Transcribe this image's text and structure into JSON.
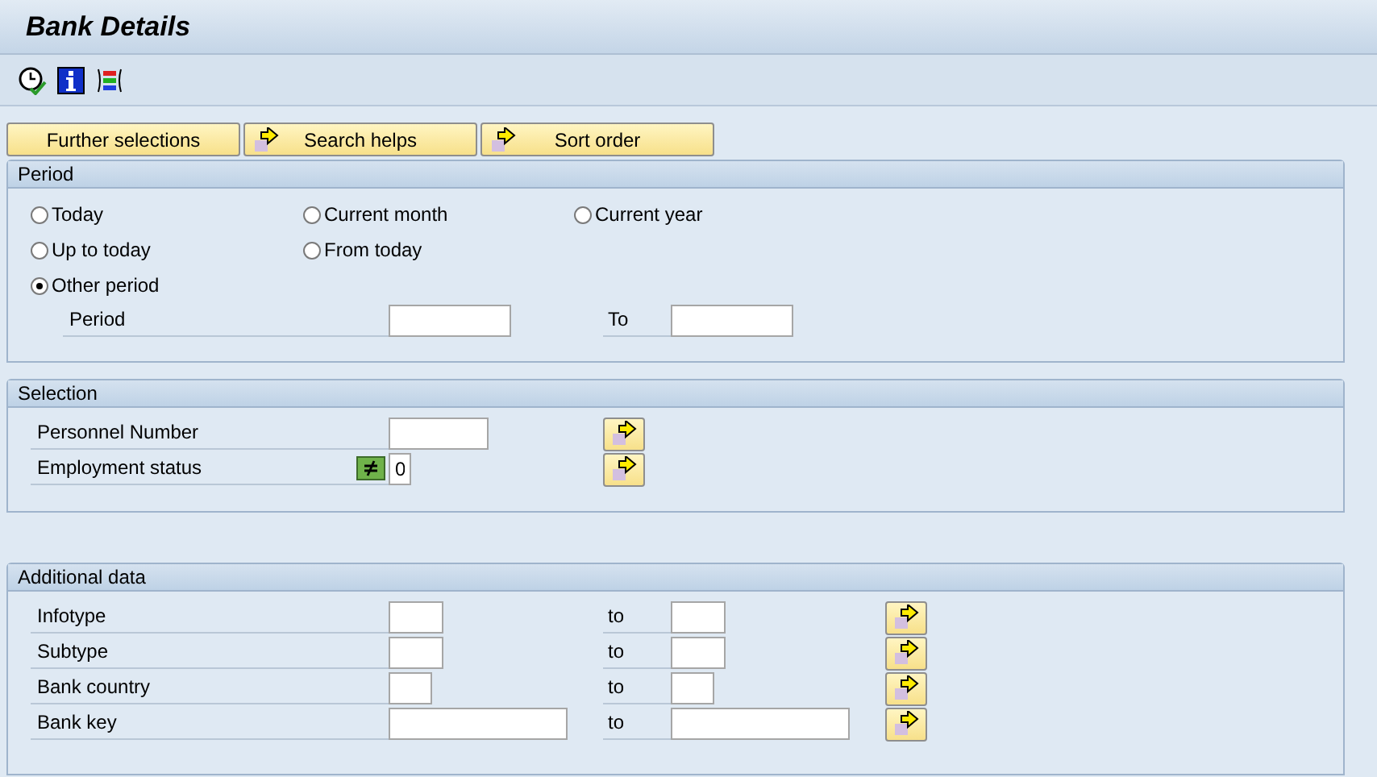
{
  "window": {
    "title": "Bank Details"
  },
  "toolbar": {
    "icons": [
      {
        "kind": "execute"
      },
      {
        "kind": "info"
      },
      {
        "kind": "selection-options"
      }
    ]
  },
  "buttons": [
    {
      "label": "Further selections",
      "kind": "plain"
    },
    {
      "label": "Search helps",
      "kind": "arrow"
    },
    {
      "label": "Sort order",
      "kind": "arrow"
    }
  ],
  "period": {
    "title": "Period",
    "options": [
      [
        {
          "label": "Today",
          "selected": false
        },
        {
          "label": "Current month",
          "selected": false
        },
        {
          "label": "Current year",
          "selected": false
        }
      ],
      [
        {
          "label": "Up to today",
          "selected": false
        },
        {
          "label": "From today",
          "selected": false
        }
      ],
      [
        {
          "label": "Other period",
          "selected": true
        }
      ]
    ],
    "range": {
      "label": "Period",
      "to_label": "To"
    }
  },
  "selection": {
    "title": "Selection",
    "rows": [
      {
        "label": "Personnel Number",
        "option": false
      },
      {
        "label": "Employment status",
        "value": "0",
        "option": true
      }
    ]
  },
  "additional": {
    "title": "Additional data",
    "rows": [
      {
        "label": "Infotype",
        "to_label": "to"
      },
      {
        "label": "Subtype",
        "to_label": "to"
      },
      {
        "label": "Bank country",
        "to_label": "to"
      },
      {
        "label": "Bank key",
        "to_label": "to"
      }
    ]
  }
}
